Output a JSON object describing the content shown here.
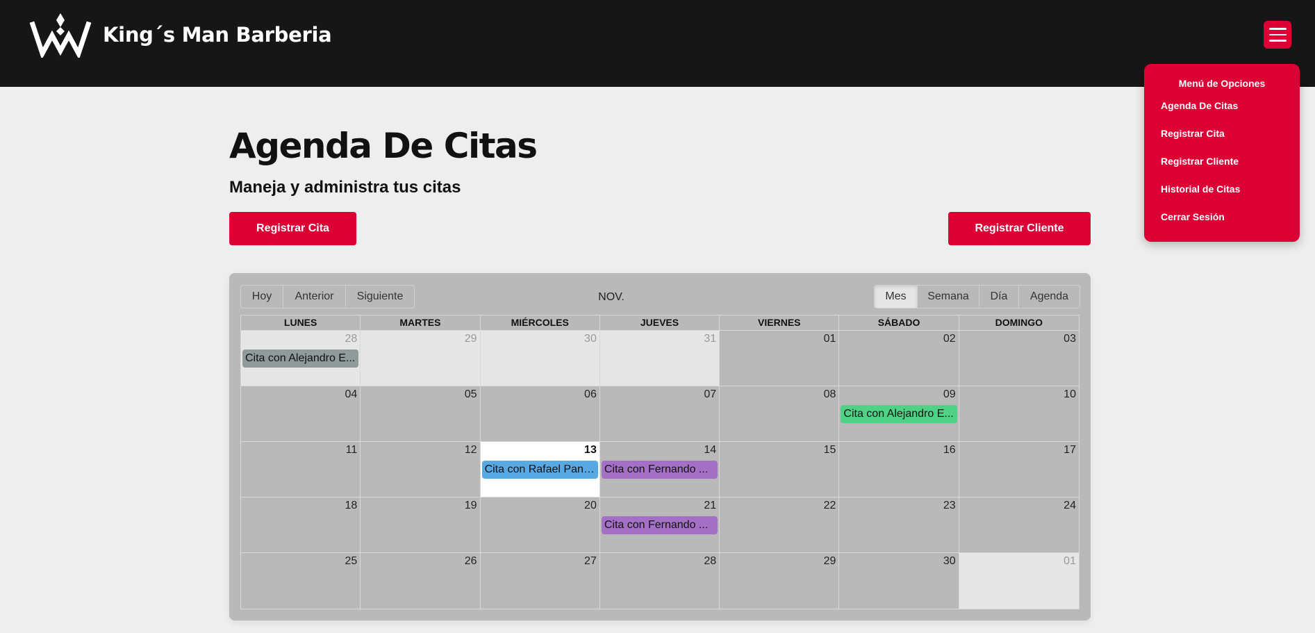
{
  "brand": {
    "name": "King´s Man Barberia"
  },
  "colors": {
    "accent": "#dc0035",
    "header_bg": "#161616",
    "page_bg": "#eeeeee"
  },
  "menu": {
    "title": "Menú de Opciones",
    "items": [
      "Agenda De Citas",
      "Registrar Cita",
      "Registrar Cliente",
      "Historial de Citas",
      "Cerrar Sesión"
    ]
  },
  "page": {
    "title": "Agenda De Citas",
    "subtitle": "Maneja y administra tus citas",
    "register_appointment_label": "Registrar Cita",
    "register_client_label": "Registrar Cliente"
  },
  "calendar": {
    "nav": [
      "Hoy",
      "Anterior",
      "Siguiente"
    ],
    "month_label": "NOV.",
    "views": [
      "Mes",
      "Semana",
      "Día",
      "Agenda"
    ],
    "active_view": "Mes",
    "weekdays": [
      "LUNES",
      "MARTES",
      "MIÉRCOLES",
      "JUEVES",
      "VIERNES",
      "SÁBADO",
      "DOMINGO"
    ],
    "weeks": [
      [
        {
          "d": "28",
          "off": true
        },
        {
          "d": "29",
          "off": true
        },
        {
          "d": "30",
          "off": true
        },
        {
          "d": "31",
          "off": true
        },
        {
          "d": "01"
        },
        {
          "d": "02"
        },
        {
          "d": "03"
        }
      ],
      [
        {
          "d": "04"
        },
        {
          "d": "05"
        },
        {
          "d": "06"
        },
        {
          "d": "07"
        },
        {
          "d": "08"
        },
        {
          "d": "09"
        },
        {
          "d": "10"
        }
      ],
      [
        {
          "d": "11"
        },
        {
          "d": "12"
        },
        {
          "d": "13",
          "today": true
        },
        {
          "d": "14"
        },
        {
          "d": "15"
        },
        {
          "d": "16"
        },
        {
          "d": "17"
        }
      ],
      [
        {
          "d": "18"
        },
        {
          "d": "19"
        },
        {
          "d": "20"
        },
        {
          "d": "21"
        },
        {
          "d": "22"
        },
        {
          "d": "23"
        },
        {
          "d": "24"
        }
      ],
      [
        {
          "d": "25"
        },
        {
          "d": "26"
        },
        {
          "d": "27"
        },
        {
          "d": "28"
        },
        {
          "d": "29"
        },
        {
          "d": "30"
        },
        {
          "d": "01",
          "off": true
        }
      ]
    ],
    "events": [
      {
        "week": 0,
        "day": 0,
        "title": "Cita con Alejandro E...",
        "color": "#8f9a9a"
      },
      {
        "week": 1,
        "day": 5,
        "title": "Cita con Alejandro E...",
        "color": "#4fd285"
      },
      {
        "week": 2,
        "day": 2,
        "title": "Cita con Rafael Pant...",
        "color": "#58a9e3"
      },
      {
        "week": 2,
        "day": 3,
        "title": "Cita con Fernando ...",
        "color": "#a470c6"
      },
      {
        "week": 3,
        "day": 3,
        "title": "Cita con Fernando ...",
        "color": "#a470c6"
      }
    ]
  }
}
